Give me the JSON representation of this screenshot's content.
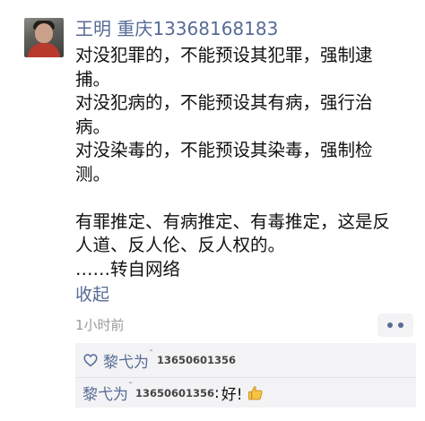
{
  "post": {
    "author_name": "王明 重庆13368168183",
    "content_lines": [
      "对没犯罪的，不能预设其犯罪，强制逮",
      "捕。",
      "对没犯病的，不能预设其有病，强行治",
      "病。",
      "对没染毒的，不能预设其染毒，强制检",
      "测。"
    ],
    "content_lines_2": [
      "有罪推定、有病推定、有毒推定，这是反",
      "人道、反人伦、反人权的。",
      "……转自网络"
    ],
    "collapse_label": "收起",
    "timestamp": "1小时前",
    "more_icon": "more-dots-icon"
  },
  "likes": {
    "icon": "heart-icon",
    "name": "黎弋为",
    "name_mark": "˜",
    "phone": "13650601356"
  },
  "comment": {
    "name": "黎弋为",
    "name_mark": "˜",
    "phone": "13650601356",
    "separator": ":",
    "text": "好!",
    "emoji": "thumbs-up-icon"
  }
}
